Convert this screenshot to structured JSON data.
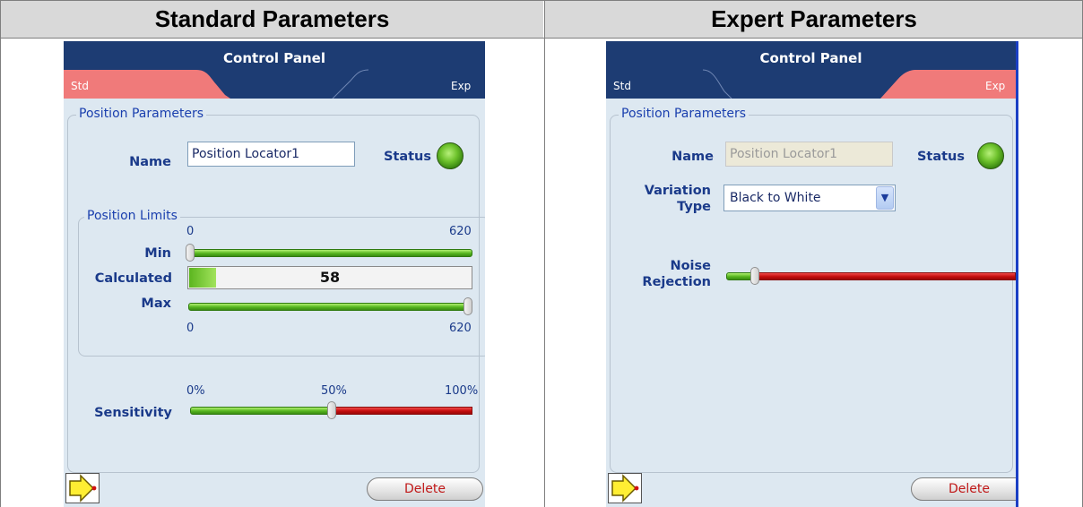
{
  "headers": {
    "standard": "Standard Parameters",
    "expert": "Expert Parameters"
  },
  "panel_title": "Control Panel",
  "tabs": {
    "std": "Std",
    "exp": "Exp"
  },
  "colors": {
    "titlebar": "#1d3c73",
    "active_tab": "#f07a7a",
    "panel_bg": "#dde8f1",
    "label": "#1a3a8a"
  },
  "standard": {
    "group_title": "Position Parameters",
    "name_label": "Name",
    "name_value": "Position Locator1",
    "status_label": "Status",
    "limits_title": "Position Limits",
    "min_label": "Min",
    "calculated_label": "Calculated",
    "max_label": "Max",
    "range_min": "0",
    "range_max": "620",
    "calculated_value": "58",
    "calculated_fraction": 0.094,
    "min_value_fraction": 0.0,
    "max_value_fraction": 1.0,
    "sensitivity_label": "Sensitivity",
    "tick_0": "0%",
    "tick_50": "50%",
    "tick_100": "100%",
    "sensitivity_fraction": 0.5,
    "delete_label": "Delete"
  },
  "expert": {
    "group_title": "Position Parameters",
    "name_label": "Name",
    "name_value": "Position Locator1",
    "status_label": "Status",
    "variation_label_1": "Variation",
    "variation_label_2": "Type",
    "variation_value": "Black to White",
    "noise_label_1": "Noise",
    "noise_label_2": "Rejection",
    "noise_fraction": 0.1,
    "delete_label": "Delete"
  },
  "icons": {
    "exit": "exit-arrow-icon",
    "dropdown": "chevron-down-icon",
    "status": "status-led-icon"
  }
}
